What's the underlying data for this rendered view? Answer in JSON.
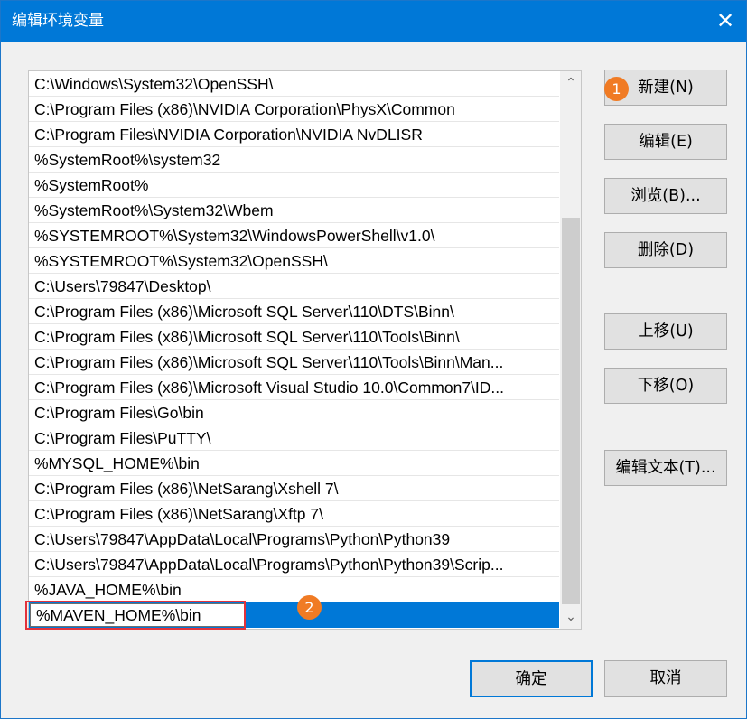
{
  "window": {
    "title": "编辑环境变量",
    "close_glyph": "✕"
  },
  "path_list": {
    "items": [
      "C:\\Windows\\System32\\OpenSSH\\",
      "C:\\Program Files (x86)\\NVIDIA Corporation\\PhysX\\Common",
      "C:\\Program Files\\NVIDIA Corporation\\NVIDIA NvDLISR",
      "%SystemRoot%\\system32",
      "%SystemRoot%",
      "%SystemRoot%\\System32\\Wbem",
      "%SYSTEMROOT%\\System32\\WindowsPowerShell\\v1.0\\",
      "%SYSTEMROOT%\\System32\\OpenSSH\\",
      "C:\\Users\\79847\\Desktop\\",
      "C:\\Program Files (x86)\\Microsoft SQL Server\\110\\DTS\\Binn\\",
      "C:\\Program Files (x86)\\Microsoft SQL Server\\110\\Tools\\Binn\\",
      "C:\\Program Files (x86)\\Microsoft SQL Server\\110\\Tools\\Binn\\Man...",
      "C:\\Program Files (x86)\\Microsoft Visual Studio 10.0\\Common7\\ID...",
      "C:\\Program Files\\Go\\bin",
      "C:\\Program Files\\PuTTY\\",
      "%MYSQL_HOME%\\bin",
      "C:\\Program Files (x86)\\NetSarang\\Xshell 7\\",
      "C:\\Program Files (x86)\\NetSarang\\Xftp 7\\",
      "C:\\Users\\79847\\AppData\\Local\\Programs\\Python\\Python39",
      "C:\\Users\\79847\\AppData\\Local\\Programs\\Python\\Python39\\Scrip...",
      "%JAVA_HOME%\\bin"
    ],
    "selected_edit_value": "%MAVEN_HOME%\\bin"
  },
  "scrollbar": {
    "up_glyph": "⌃",
    "down_glyph": "⌄"
  },
  "buttons": {
    "new": "新建(N)",
    "edit": "编辑(E)",
    "browse": "浏览(B)...",
    "delete": "删除(D)",
    "move_up": "上移(U)",
    "move_down": "下移(O)",
    "edit_text": "编辑文本(T)...",
    "ok": "确定",
    "cancel": "取消"
  },
  "annotations": {
    "marker_1": "1",
    "marker_2": "2",
    "marker_color": "#f07b24",
    "highlight_color": "#e3323b"
  },
  "colors": {
    "titlebar": "#0078d7",
    "selection": "#0078d7"
  }
}
